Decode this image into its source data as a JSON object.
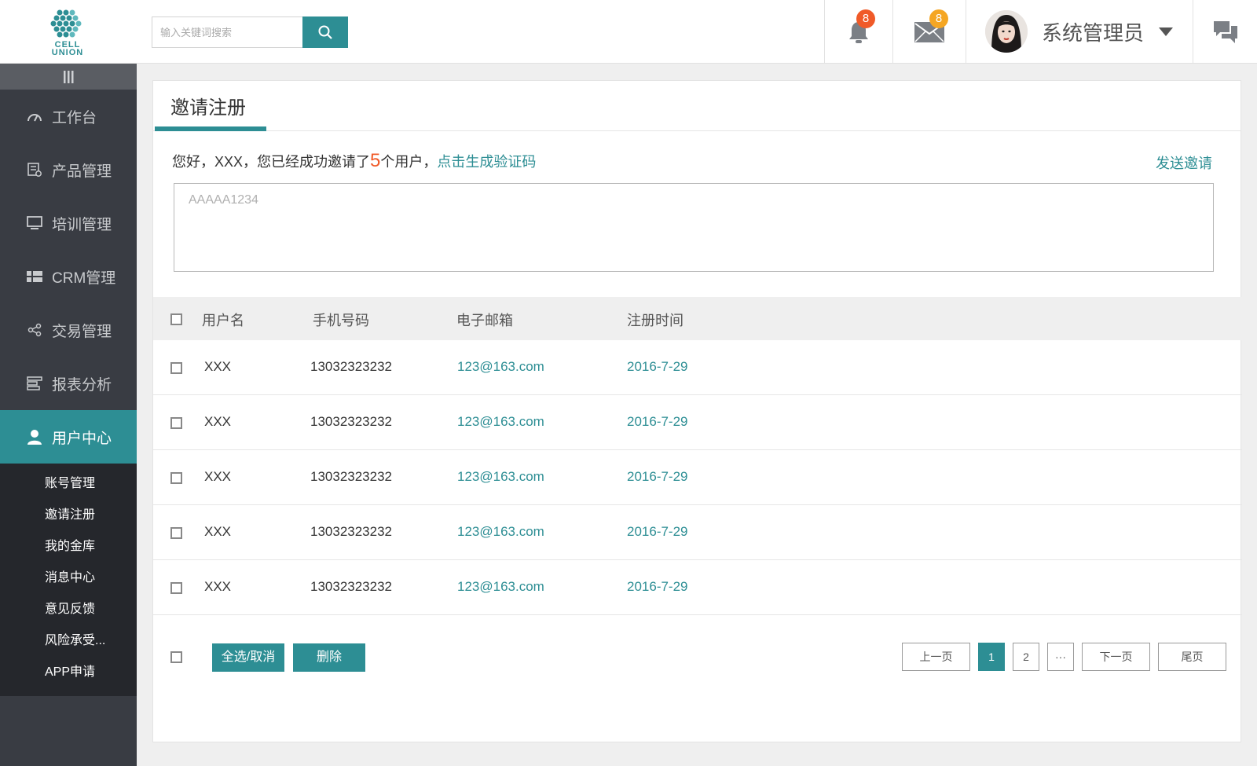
{
  "brand": {
    "logo_text_1": "CELL",
    "logo_text_2": "UNION",
    "accent": "#2d8e94",
    "alert": "#f05a28",
    "badge_yellow": "#f5a623"
  },
  "search": {
    "placeholder": "输入关键词搜索",
    "icon": "search-icon"
  },
  "header": {
    "notifications": {
      "icon": "bell-icon",
      "count": "8"
    },
    "messages": {
      "icon": "envelope-icon",
      "count": "8"
    },
    "user": {
      "name": "系统管理员",
      "icon": "chevron-down-icon"
    },
    "chat": {
      "icon": "chat-bubbles-icon"
    }
  },
  "sidebar": {
    "collapse_icon": "menu-bars-icon",
    "items": [
      {
        "label": "工作台",
        "icon": "gauge-icon"
      },
      {
        "label": "产品管理",
        "icon": "product-icon"
      },
      {
        "label": "培训管理",
        "icon": "monitor-icon"
      },
      {
        "label": "CRM管理",
        "icon": "grid-icon"
      },
      {
        "label": "交易管理",
        "icon": "share-icon"
      },
      {
        "label": "报表分析",
        "icon": "report-icon"
      },
      {
        "label": "用户中心",
        "icon": "user-icon"
      }
    ],
    "sub_items": [
      "账号管理",
      "邀请注册",
      "我的金库",
      "消息中心",
      "意见反馈",
      "风险承受...",
      "APP申请"
    ]
  },
  "main": {
    "title": "邀请注册",
    "invite": {
      "prefix": "您好，XXX，您已经成功邀请了",
      "count": "5",
      "suffix": "个用户，",
      "link": "点击生成验证码"
    },
    "send_label": "发送邀请",
    "code_placeholder": "AAAAA1234",
    "table": {
      "columns": [
        "用户名",
        "手机号码",
        "电子邮箱",
        "注册时间"
      ],
      "rows": [
        {
          "name": "XXX",
          "phone": "13032323232",
          "email": "123@163.com",
          "date": "2016-7-29"
        },
        {
          "name": "XXX",
          "phone": "13032323232",
          "email": "123@163.com",
          "date": "2016-7-29"
        },
        {
          "name": "XXX",
          "phone": "13032323232",
          "email": "123@163.com",
          "date": "2016-7-29"
        },
        {
          "name": "XXX",
          "phone": "13032323232",
          "email": "123@163.com",
          "date": "2016-7-29"
        },
        {
          "name": "XXX",
          "phone": "13032323232",
          "email": "123@163.com",
          "date": "2016-7-29"
        }
      ]
    },
    "footer": {
      "select_all": "全选/取消",
      "delete": "删除",
      "pagination": {
        "prev": "上一页",
        "pages": [
          "1",
          "2"
        ],
        "ellipsis": "···",
        "next": "下一页",
        "last": "尾页",
        "current": "1"
      }
    }
  }
}
